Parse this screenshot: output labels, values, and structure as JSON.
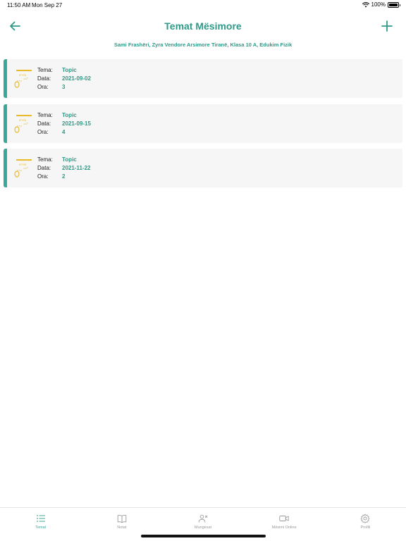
{
  "status_bar": {
    "time": "11:50 AM",
    "date": "Mon Sep 27",
    "battery": "100%"
  },
  "nav": {
    "title": "Temat Mësimore",
    "back_icon": "arrow-left-icon",
    "add_icon": "plus-icon"
  },
  "subtitle": "Sami Frashëri, Zyra Vendore Arsimore Tiranë, Klasa 10 A, Edukim Fizik",
  "labels": {
    "tema": "Tema:",
    "data": "Data:",
    "ora": "Ora:"
  },
  "topics": [
    {
      "tema": "Topic",
      "data": "2021-09-02",
      "ora": "3"
    },
    {
      "tema": "Topic",
      "data": "2021-09-15",
      "ora": "4"
    },
    {
      "tema": "Topic",
      "data": "2021-11-22",
      "ora": "2"
    }
  ],
  "tabs": [
    {
      "label": "Temat",
      "icon": "list-icon",
      "active": true
    },
    {
      "label": "Notat",
      "icon": "book-icon",
      "active": false
    },
    {
      "label": "Mungesat",
      "icon": "person-x-icon",
      "active": false
    },
    {
      "label": "Mësimi Online",
      "icon": "video-icon",
      "active": false
    },
    {
      "label": "Profili",
      "icon": "gear-icon",
      "active": false
    }
  ],
  "colors": {
    "accent": "#2e9a87",
    "card_bar": "#3aa899",
    "icon_yellow": "#e6bb2e",
    "card_bg": "#f6f6f6",
    "inactive": "#9a9a9a"
  }
}
